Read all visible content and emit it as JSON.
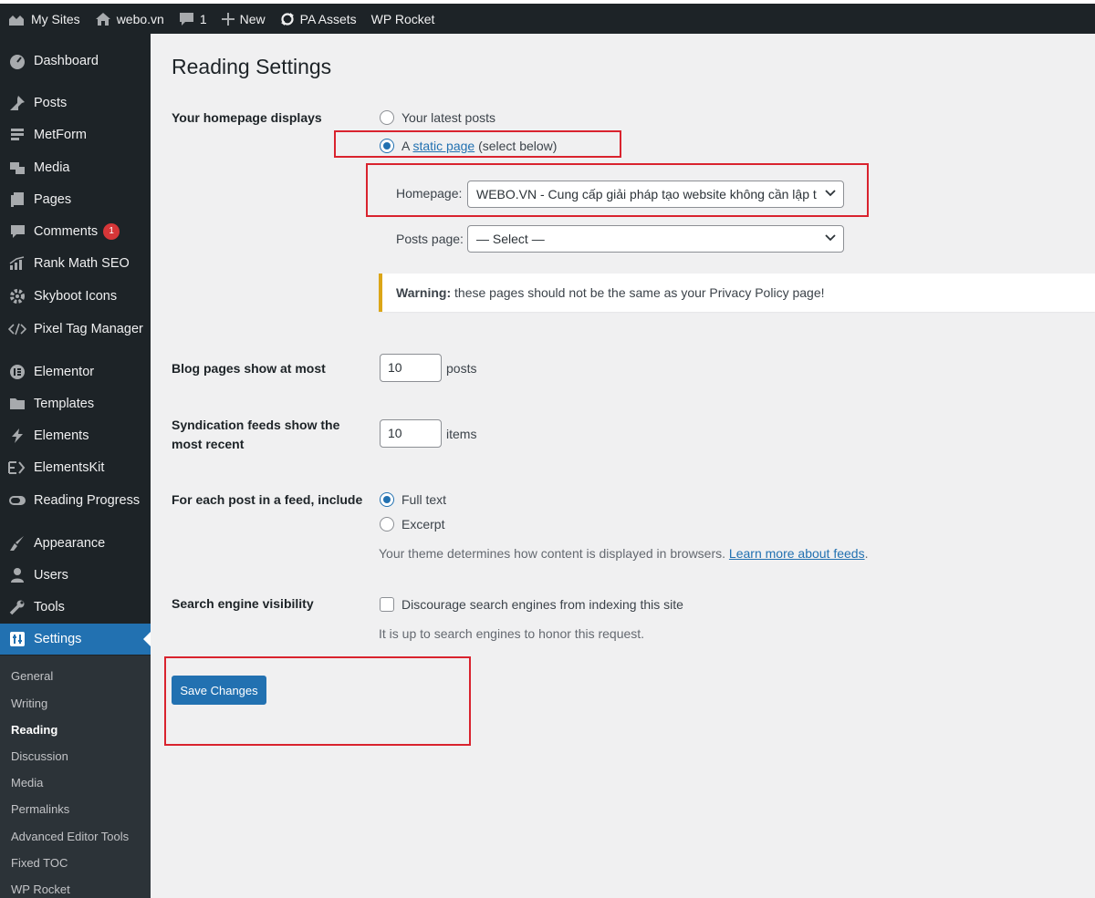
{
  "adminbar": {
    "items": [
      {
        "label": "My Sites",
        "icon": "my-sites-icon"
      },
      {
        "label": "webo.vn",
        "icon": "home-icon"
      },
      {
        "label": "1",
        "icon": "comment-icon"
      },
      {
        "label": "New",
        "icon": "plus-icon"
      },
      {
        "label": "PA Assets",
        "icon": "refresh-icon"
      },
      {
        "label": "WP Rocket",
        "icon": ""
      }
    ]
  },
  "sidebar": {
    "items": [
      {
        "label": "Dashboard",
        "icon": "dashboard-icon"
      },
      {
        "label": "Posts",
        "icon": "pin-icon"
      },
      {
        "label": "MetForm",
        "icon": "form-icon"
      },
      {
        "label": "Media",
        "icon": "media-icon"
      },
      {
        "label": "Pages",
        "icon": "pages-icon"
      },
      {
        "label": "Comments",
        "icon": "comment-icon",
        "badge": "1"
      },
      {
        "label": "Rank Math SEO",
        "icon": "chart-icon"
      },
      {
        "label": "Skyboot Icons",
        "icon": "gear-icon"
      },
      {
        "label": "Pixel Tag Manager",
        "icon": "code-icon"
      },
      {
        "label": "Elementor",
        "icon": "elementor-icon"
      },
      {
        "label": "Templates",
        "icon": "folder-icon"
      },
      {
        "label": "Elements",
        "icon": "bolt-icon"
      },
      {
        "label": "ElementsKit",
        "icon": "ek-icon"
      },
      {
        "label": "Reading Progress",
        "icon": "toggle-icon"
      },
      {
        "label": "Appearance",
        "icon": "brush-icon"
      },
      {
        "label": "Users",
        "icon": "user-icon"
      },
      {
        "label": "Tools",
        "icon": "wrench-icon"
      },
      {
        "label": "Settings",
        "icon": "settings-icon"
      }
    ],
    "submenu": [
      "General",
      "Writing",
      "Reading",
      "Discussion",
      "Media",
      "Permalinks",
      "Advanced Editor Tools",
      "Fixed TOC",
      "WP Rocket"
    ]
  },
  "page": {
    "title": "Reading Settings",
    "homepage_displays": {
      "label": "Your homepage displays",
      "opt_latest": "Your latest posts",
      "opt_static_prefix": "A",
      "opt_static_link": "static page",
      "opt_static_suffix": "(select below)",
      "homepage_label": "Homepage:",
      "homepage_value": "WEBO.VN - Cung cấp giải pháp tạo website không cần lập t",
      "postspage_label": "Posts page:",
      "postspage_value": "— Select —"
    },
    "warning": {
      "bold": "Warning:",
      "text": "these pages should not be the same as your Privacy Policy page!"
    },
    "blog_pages": {
      "label": "Blog pages show at most",
      "value": "10",
      "unit": "posts"
    },
    "syndication": {
      "label_line1": "Syndication feeds show the",
      "label_line2": "most recent",
      "value": "10",
      "unit": "items"
    },
    "feed_include": {
      "label": "For each post in a feed, include",
      "opt_full": "Full text",
      "opt_excerpt": "Excerpt",
      "note_prefix": "Your theme determines how content is displayed in browsers.",
      "note_link": "Learn more about feeds",
      "note_suffix": "."
    },
    "search_visibility": {
      "label": "Search engine visibility",
      "checkbox_label": "Discourage search engines from indexing this site",
      "note": "It is up to search engines to honor this request."
    },
    "save_button": "Save Changes"
  },
  "colors": {
    "accent": "#2271b1",
    "annotation": "#d9232e",
    "warning": "#dba617",
    "sidebar": "#1d2327"
  }
}
